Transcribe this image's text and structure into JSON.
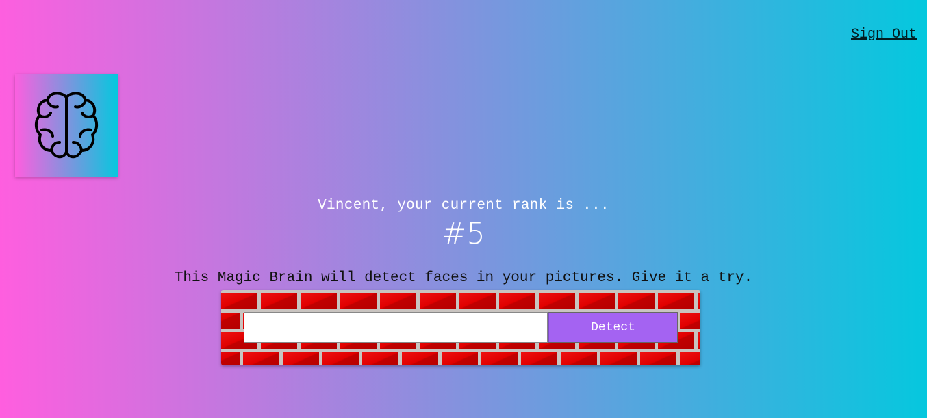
{
  "nav": {
    "sign_out_label": "Sign Out"
  },
  "logo": {
    "icon": "brain-icon"
  },
  "rank": {
    "title": "Vincent, your current rank is ...",
    "value": "#5"
  },
  "image_link_form": {
    "description": "This Magic Brain will detect faces in your pictures. Give it a try.",
    "input_value": "",
    "input_placeholder": "",
    "detect_label": "Detect"
  },
  "colors": {
    "gradient_start": "#ff5edf",
    "gradient_end": "#04c8de",
    "detect_button": "#a463f2",
    "brick": "#dd0000",
    "mortar": "#c9c4c0"
  }
}
